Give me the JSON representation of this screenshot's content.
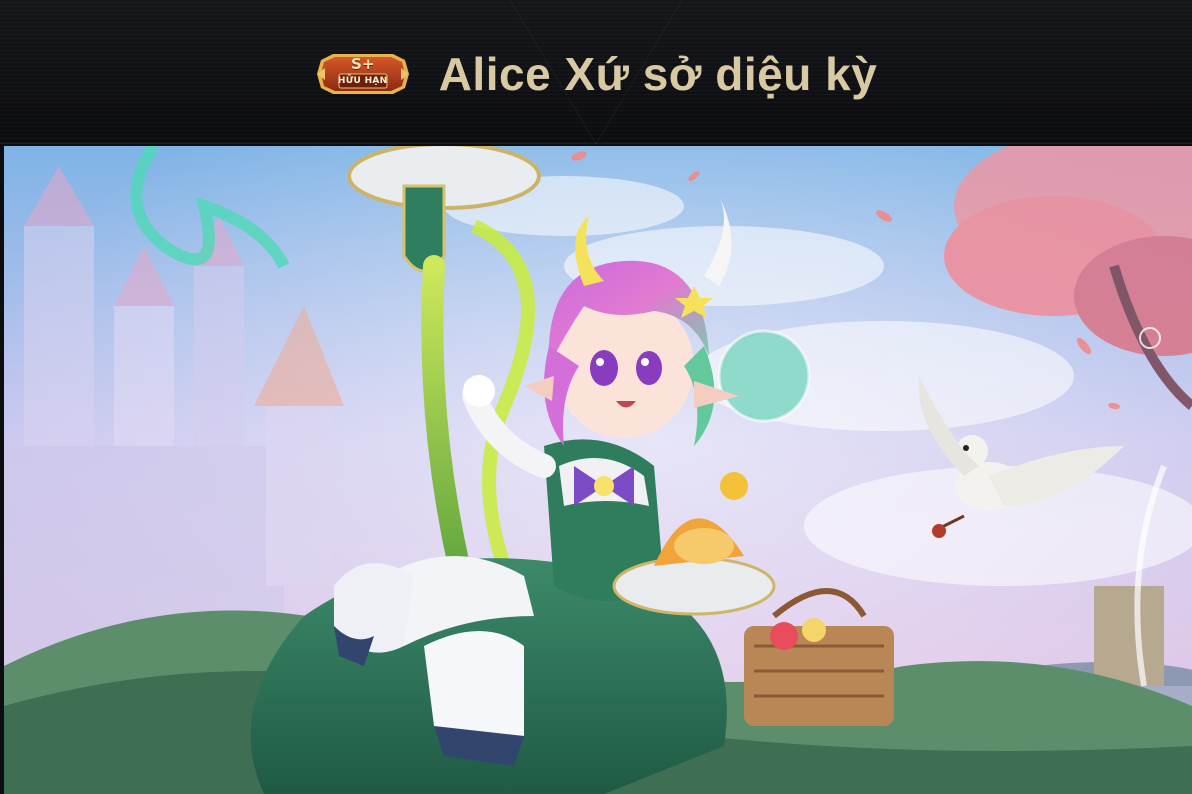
{
  "header": {
    "badge": {
      "tier": "S+",
      "label": "HỮU HẠN"
    },
    "title": "Alice Xứ sở diệu kỳ"
  },
  "colors": {
    "title": "#d9c9a3",
    "badge_fill": "#b8401c",
    "badge_border": "#e7b34a",
    "header_bg": "#0f1013"
  },
  "art": {
    "character": "alice-wonderland-skin"
  }
}
